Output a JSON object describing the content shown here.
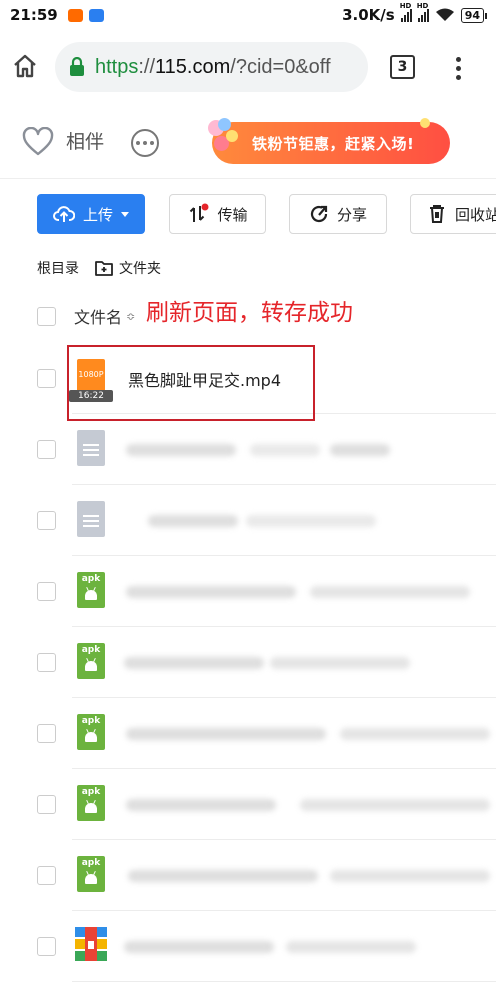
{
  "status_bar": {
    "time": "21:59",
    "speed": "3.0K/s",
    "battery": "94"
  },
  "browser": {
    "url_scheme": "https",
    "url_sep": "://",
    "url_host": "115.com",
    "url_rest": "/?cid=0&off",
    "tab_count": "3"
  },
  "header": {
    "app_name": "相伴",
    "promo_text": "铁粉节钜惠，赶紧入场!"
  },
  "toolbar": {
    "upload_label": "上传",
    "transfer_label": "传输",
    "share_label": "分享",
    "recycle_label": "回收站"
  },
  "breadcrumb": {
    "root": "根目录",
    "folder": "文件夹"
  },
  "list_header": {
    "name_column": "文件名",
    "sort_glyph": "≎",
    "annotation": "刷新页面，转存成功"
  },
  "files": [
    {
      "type": "video",
      "name": "黑色脚趾甲足交.mp4",
      "resolution": "1080P",
      "duration": "16:22"
    },
    {
      "type": "doc"
    },
    {
      "type": "doc"
    },
    {
      "type": "apk",
      "badge": "apk"
    },
    {
      "type": "apk",
      "badge": "apk"
    },
    {
      "type": "apk",
      "badge": "apk"
    },
    {
      "type": "apk",
      "badge": "apk"
    },
    {
      "type": "apk",
      "badge": "apk"
    },
    {
      "type": "archive"
    }
  ],
  "colors": {
    "accent": "#2a7ff0",
    "annotation": "#e5252a",
    "highlight_border": "#c8212b",
    "apk": "#6cb33e",
    "video": "#ff8a1e",
    "url_scheme": "#1e8e3e"
  }
}
